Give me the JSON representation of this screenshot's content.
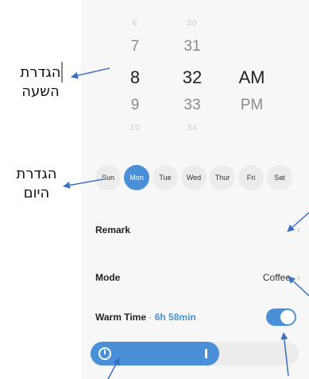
{
  "annotations": {
    "time_setting": "הגדרת השעה",
    "day_setting": "הגדרת היום"
  },
  "time_picker": {
    "hours": [
      "6",
      "7",
      "8",
      "9",
      "10"
    ],
    "minutes": [
      "30",
      "31",
      "32",
      "33",
      "34"
    ],
    "periods": [
      "AM",
      "PM"
    ],
    "selected": {
      "hour": "8",
      "minute": "32",
      "period": "AM"
    }
  },
  "days": [
    {
      "label": "Sun",
      "active": false
    },
    {
      "label": "Mon",
      "active": true
    },
    {
      "label": "Tue",
      "active": false
    },
    {
      "label": "Wed",
      "active": false
    },
    {
      "label": "Thur",
      "active": false
    },
    {
      "label": "Fri",
      "active": false
    },
    {
      "label": "Sat",
      "active": false
    }
  ],
  "remark": {
    "label": "Remark",
    "chevron": "›"
  },
  "mode": {
    "label": "Mode",
    "value": "Coffee",
    "chevron": "›"
  },
  "warm": {
    "label": "Warm Time",
    "separator": "·",
    "duration": "6h 58min",
    "enabled": true
  },
  "slider": {
    "level": 0.62
  },
  "colors": {
    "accent": "#4a90d9",
    "annotation_arrow": "#3b6fc4"
  }
}
